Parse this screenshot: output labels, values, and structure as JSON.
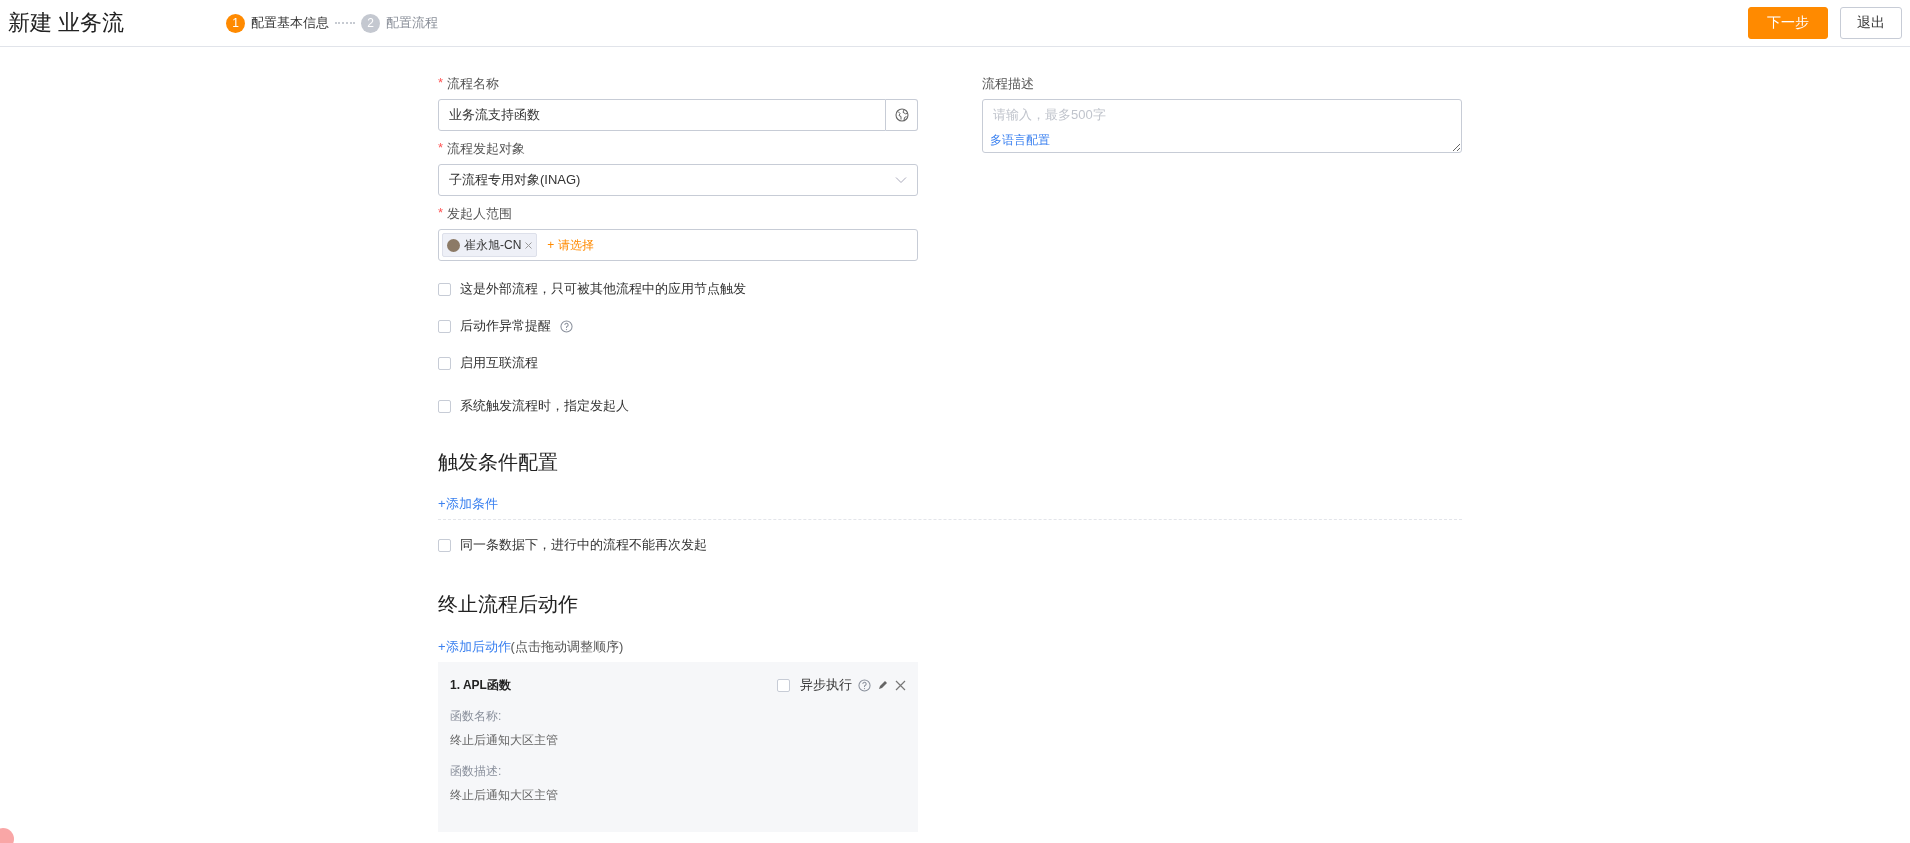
{
  "header": {
    "title": "新建 业务流",
    "steps": [
      {
        "number": "1",
        "label": "配置基本信息",
        "selected": true
      },
      {
        "number": "2",
        "label": "配置流程",
        "selected": false
      }
    ],
    "buttons": [
      {
        "label": "下一步",
        "kind": "primary"
      },
      {
        "label": "退出",
        "kind": "default"
      }
    ]
  },
  "basic": {
    "name_field": {
      "label": "流程名称",
      "required_mark": "*",
      "value": "业务流支持函数"
    },
    "object_select": {
      "label": "流程发起对象",
      "required_mark": "*",
      "value": "子流程专用对象(INAG)"
    },
    "initiator": {
      "label": "发起人范围",
      "required_mark": "*",
      "tags": [
        {
          "label": "崔永旭-CN"
        }
      ],
      "add_link": "+ 请选择"
    },
    "checkboxes": [
      {
        "label": "这是外部流程，只可被其他流程中的应用节点触发",
        "checked": false,
        "help": false
      },
      {
        "label": "后动作异常提醒",
        "checked": false,
        "help": true
      },
      {
        "label": "启用互联流程",
        "checked": false,
        "help": false
      },
      {
        "label": "系统触发流程时，指定发起人",
        "checked": false,
        "help": false
      }
    ],
    "description": {
      "label": "流程描述",
      "placeholder": "请输入，最多500字",
      "link": "多语言配置"
    }
  },
  "trigger": {
    "title": "触发条件配置",
    "add_link": "+添加条件",
    "checkbox": {
      "label": "同一条数据下，进行中的流程不能再次发起",
      "checked": false
    }
  },
  "post_actions": {
    "title": "终止流程后动作",
    "add_link": "+添加后动作",
    "hint": "(点击拖动调整顺序)",
    "cards": [
      {
        "title": "1. APL函数",
        "async": {
          "label": "异步执行",
          "checked": false
        },
        "fields": [
          {
            "label": "函数名称:",
            "value": "终止后通知大区主管"
          },
          {
            "label": "函数描述:",
            "value": "终止后通知大区主管"
          }
        ]
      }
    ]
  }
}
